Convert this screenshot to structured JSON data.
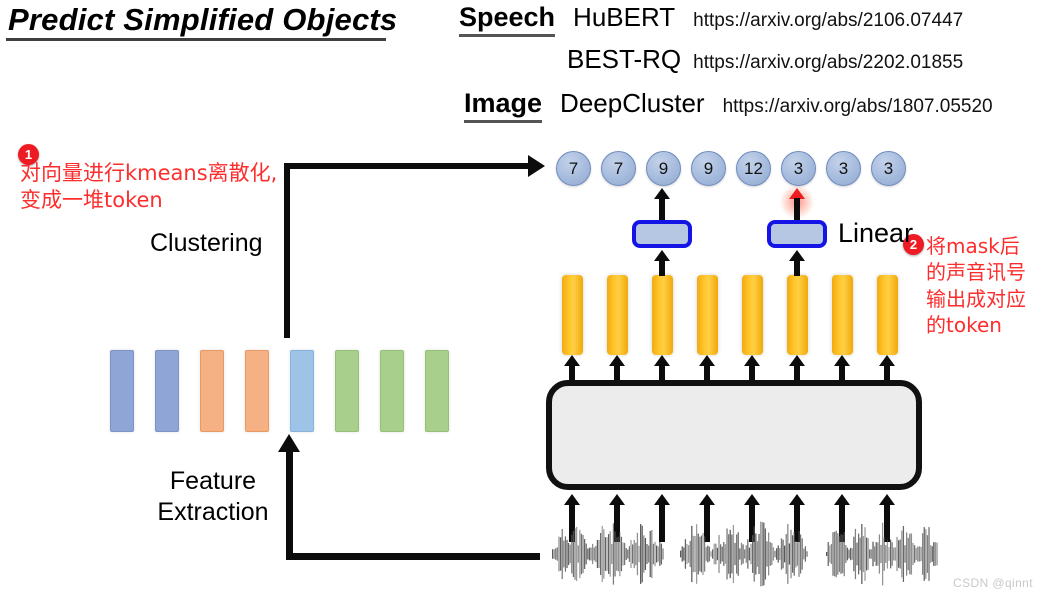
{
  "header": {
    "title": "Predict Simplified Objects",
    "references": [
      {
        "category": "Speech",
        "model": "HuBERT",
        "url": "https://arxiv.org/abs/2106.07447"
      },
      {
        "category": "",
        "model": "BEST-RQ",
        "url": "https://arxiv.org/abs/2202.01855"
      },
      {
        "category": "Image",
        "model": "DeepCluster",
        "url": "https://arxiv.org/abs/1807.05520"
      }
    ]
  },
  "annotations": [
    {
      "number": "1",
      "text": "对向量进行kmeans离散化,\n变成一堆token",
      "color": "#fe2d2d"
    },
    {
      "number": "2",
      "text": "将mask后\n的声音讯号\n输出成对应\n的token",
      "color": "#fe2d2d"
    }
  ],
  "labels": {
    "clustering": "Clustering",
    "feature_extraction": "Feature\nExtraction",
    "linear": "Linear"
  },
  "tokens": [
    {
      "value": "7"
    },
    {
      "value": "7"
    },
    {
      "value": "9"
    },
    {
      "value": "9"
    },
    {
      "value": "12"
    },
    {
      "value": "3"
    },
    {
      "value": "3"
    },
    {
      "value": "3"
    }
  ],
  "cluster_bars": [
    {
      "color": "#8fa5d6",
      "border": "#7d93c8"
    },
    {
      "color": "#8fa5d6",
      "border": "#7d93c8"
    },
    {
      "color": "#f5b183",
      "border": "#e99a63"
    },
    {
      "color": "#f5b183",
      "border": "#e99a63"
    },
    {
      "color": "#9dc3e6",
      "border": "#86b2dd"
    },
    {
      "color": "#a9cf8d",
      "border": "#96c077"
    },
    {
      "color": "#a9cf8d",
      "border": "#96c077"
    },
    {
      "color": "#a9cf8d",
      "border": "#96c077"
    }
  ],
  "feature_vectors": {
    "count": 8,
    "color": "#ffc000"
  },
  "linear_boxes": [
    {
      "index": 2,
      "highlighted": false
    },
    {
      "index": 5,
      "highlighted": true
    }
  ],
  "transformer": {
    "fill": "#ececec",
    "border": "#111111"
  },
  "waveforms": {
    "segments": 3,
    "color": "#555555"
  },
  "watermark": "CSDN @qinnt",
  "colors": {
    "accent_red": "#ed1c24",
    "token_blue": "#a3b9dc",
    "linear_border": "#1414e6",
    "feature_orange": "#ffc000"
  }
}
